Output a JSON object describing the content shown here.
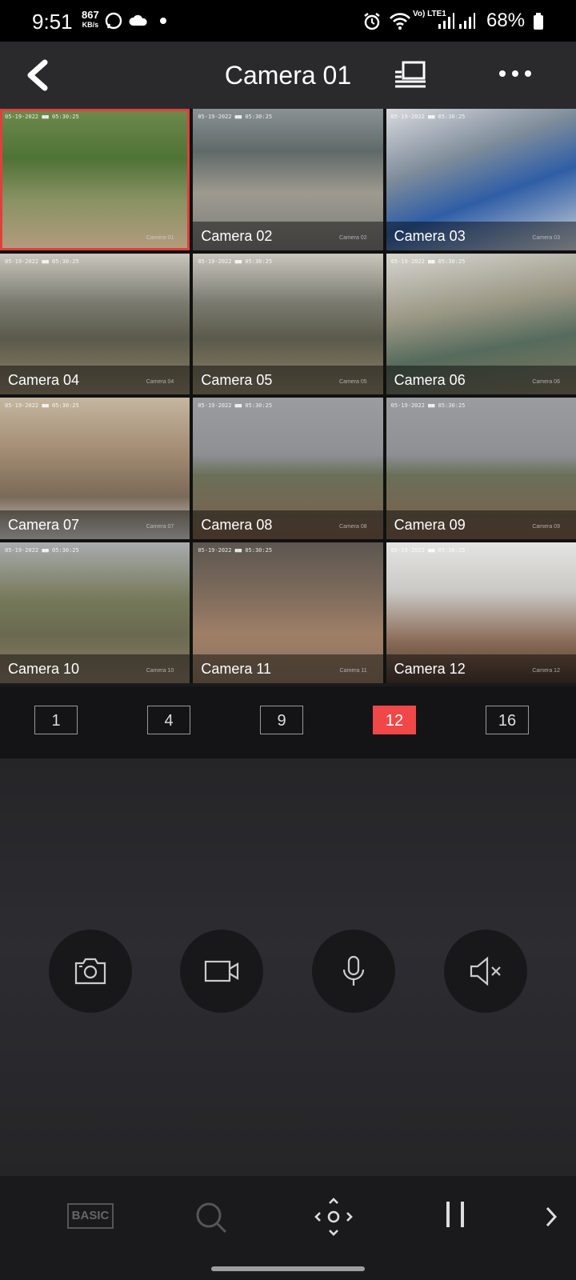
{
  "status_bar": {
    "time": "9:51",
    "speed_value": "867",
    "speed_unit": "KB/s",
    "network": "Vo) LTE1",
    "battery": "68%"
  },
  "header": {
    "title": "Camera 01"
  },
  "cameras": [
    {
      "label": "Camera 01",
      "osd": "05-19-2022 ■■ 05:30:25",
      "scene": "garden"
    },
    {
      "label": "Camera 02",
      "osd": "05-19-2022 ■■ 05:30:25",
      "scene": "yard"
    },
    {
      "label": "Camera 03",
      "osd": "05-19-2022 ■■ 05:30:25",
      "scene": "storage"
    },
    {
      "label": "Camera 04",
      "osd": "05-19-2022 ■■ 05:30:25",
      "scene": "factory"
    },
    {
      "label": "Camera 05",
      "osd": "05-19-2022 ■■ 05:30:25",
      "scene": "factory"
    },
    {
      "label": "Camera 06",
      "osd": "05-19-2022 ■■ 05:30:25",
      "scene": "conveyor"
    },
    {
      "label": "Camera 07",
      "osd": "05-19-2022 ■■ 05:30:25",
      "scene": "warehouse"
    },
    {
      "label": "Camera 08",
      "osd": "05-19-2022 ■■ 05:30:25",
      "scene": "field"
    },
    {
      "label": "Camera 09",
      "osd": "05-19-2022 ■■ 05:30:25",
      "scene": "field"
    },
    {
      "label": "Camera 10",
      "osd": "05-19-2022 ■■ 05:30:25",
      "scene": "path"
    },
    {
      "label": "Camera 11",
      "osd": "05-19-2022 ■■ 05:30:25",
      "scene": "ground"
    },
    {
      "label": "Camera 12",
      "osd": "05-19-2022 ■■ 05:30:25",
      "scene": "office"
    }
  ],
  "split_options": [
    "1",
    "4",
    "9",
    "12",
    "16"
  ],
  "active_split": "12",
  "controls": [
    {
      "name": "snapshot-button",
      "icon": "camera-icon"
    },
    {
      "name": "record-button",
      "icon": "video-icon"
    },
    {
      "name": "talk-button",
      "icon": "microphone-icon"
    },
    {
      "name": "audio-button",
      "icon": "speaker-muted-icon"
    }
  ],
  "toolbar": {
    "quality_label": "BASIC"
  },
  "colors": {
    "accent": "#f04848",
    "selected_border": "#e0403c"
  }
}
